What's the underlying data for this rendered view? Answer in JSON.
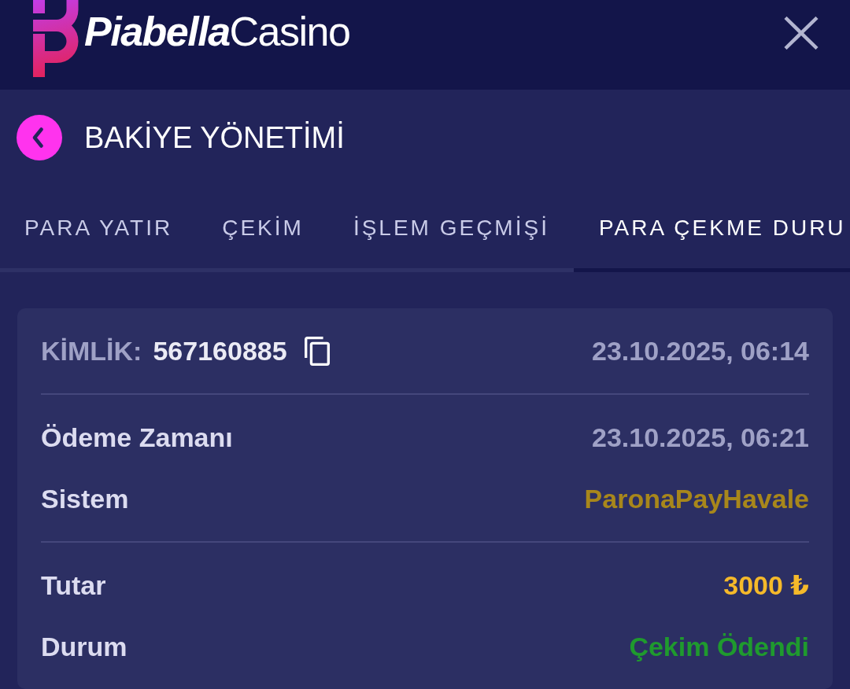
{
  "header": {
    "logo": "**Piabella**Casino"
  },
  "page": {
    "title": "BAKİYE YÖNETİMİ"
  },
  "tabs": [
    {
      "label": "PARA YATIR",
      "selected": false
    },
    {
      "label": "ÇEKİM",
      "selected": false
    },
    {
      "label": "İŞLEM GEÇMİŞİ",
      "selected": false
    },
    {
      "label": "PARA ÇEKME DURU",
      "selected": true
    }
  ],
  "withdrawal": {
    "id_label": "KİMLİK:",
    "id_value": "567160885",
    "created_at": "23.10.2025, 06:14",
    "sections": [
      {
        "rows": [
          {
            "label": "Ödeme Zamanı",
            "value": "23.10.2025, 06:21",
            "color": "#9fa1c6"
          },
          {
            "label": "Sistem",
            "value": "ParonaPayHavale",
            "color": "#a8871b"
          }
        ]
      },
      {
        "rows": [
          {
            "label": "Tutar",
            "value": "3000 ₺",
            "color": "#f5b92a"
          },
          {
            "label": "Durum",
            "value": "Çekim Ödendi",
            "color": "#1f9a2e"
          }
        ]
      }
    ]
  }
}
